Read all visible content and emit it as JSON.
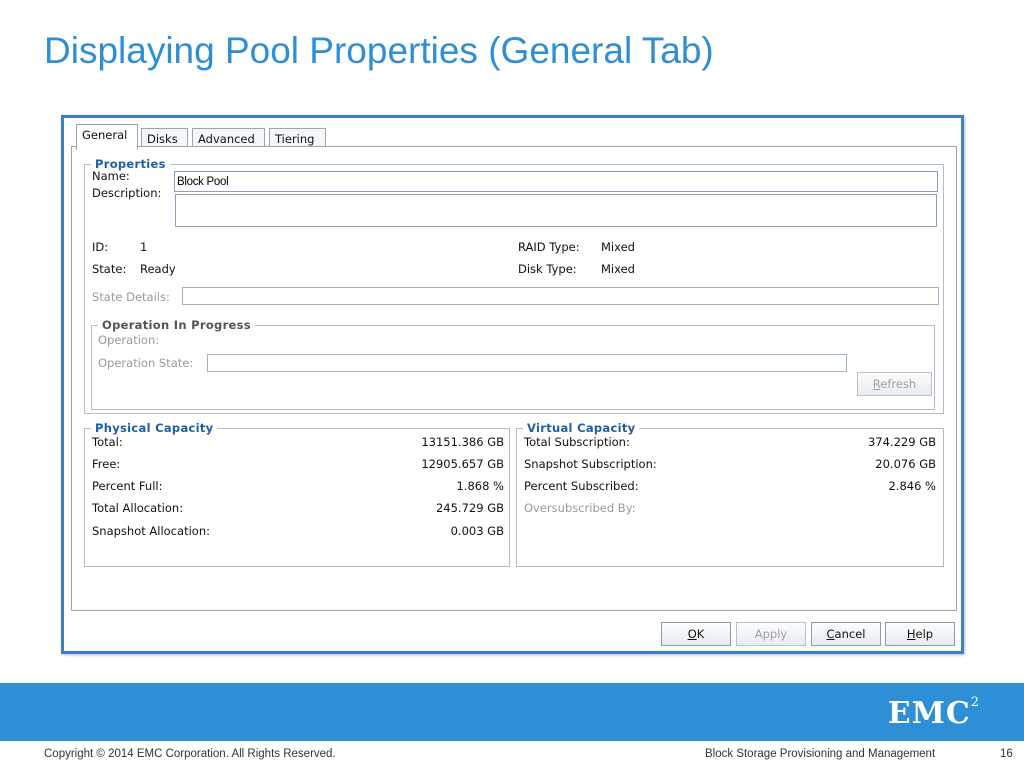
{
  "slide": {
    "title": "Displaying Pool Properties (General Tab)"
  },
  "dialog": {
    "tabs": [
      "General",
      "Disks",
      "Advanced",
      "Tiering"
    ],
    "active_tab": "General",
    "properties": {
      "legend": "Properties",
      "name_label": "Name:",
      "name_value": "Block Pool",
      "description_label": "Description:",
      "description_value": "",
      "id_label": "ID:",
      "id_value": "1",
      "state_label": "State:",
      "state_value": "Ready",
      "raid_type_label": "RAID Type:",
      "raid_type_value": "Mixed",
      "disk_type_label": "Disk Type:",
      "disk_type_value": "Mixed",
      "state_details_label": "State Details:",
      "state_details_value": ""
    },
    "operation": {
      "legend": "Operation In Progress",
      "operation_label": "Operation:",
      "operation_state_label": "Operation State:",
      "operation_state_value": "",
      "refresh_prefix": "",
      "refresh_mnemonic": "R",
      "refresh_rest": "efresh"
    },
    "physical_capacity": {
      "legend": "Physical Capacity",
      "rows": [
        {
          "label": "Total:",
          "value": "13151.386 GB"
        },
        {
          "label": "Free:",
          "value": "12905.657 GB"
        },
        {
          "label": "Percent Full:",
          "value": "1.868 %"
        },
        {
          "label": "Total Allocation:",
          "value": "245.729 GB"
        },
        {
          "label": "Snapshot Allocation:",
          "value": "0.003 GB"
        }
      ]
    },
    "virtual_capacity": {
      "legend": "Virtual Capacity",
      "rows": [
        {
          "label": "Total Subscription:",
          "value": "374.229 GB"
        },
        {
          "label": "Snapshot Subscription:",
          "value": "20.076 GB"
        },
        {
          "label": "Percent Subscribed:",
          "value": "2.846 %"
        }
      ],
      "oversubscribed_label": "Oversubscribed By:"
    },
    "buttons": {
      "ok_mnemonic": "O",
      "ok_rest": "K",
      "apply_label": "Apply",
      "cancel_mnemonic": "C",
      "cancel_rest": "ancel",
      "help_mnemonic": "H",
      "help_rest": "elp"
    }
  },
  "footer": {
    "brand": "EMC",
    "brand_sup": "2",
    "copyright": "Copyright © 2014 EMC Corporation. All Rights Reserved.",
    "course": "Block Storage Provisioning and Management",
    "page_number": "16"
  },
  "colors": {
    "title_blue": "#2e8fd6",
    "band_blue": "#2e8fd6",
    "legend_blue": "#1f5ea8",
    "window_border": "#3c7fc2"
  }
}
